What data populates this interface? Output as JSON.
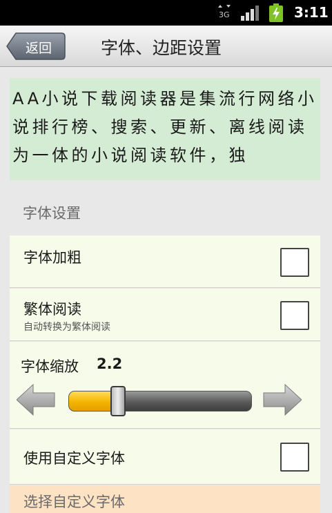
{
  "status_bar": {
    "network_label": "3G",
    "time": "3:11"
  },
  "title_bar": {
    "back_label": "返回",
    "title": "字体、边距设置"
  },
  "preview": {
    "text": "AA小说下载阅读器是集流行网络小说排行榜、搜索、更新、离线阅读为一体的小说阅读软件，独"
  },
  "font_settings": {
    "section_title": "字体设置",
    "bold": {
      "label": "字体加粗",
      "checked": false
    },
    "traditional": {
      "label": "繁体阅读",
      "sublabel": "自动转换为繁体阅读",
      "checked": false
    },
    "zoom": {
      "label": "字体缩放",
      "value": "2.2",
      "slider_fraction": 0.27
    },
    "custom_font": {
      "label": "使用自定义字体",
      "checked": false
    },
    "choose_custom_font": {
      "label": "选择自定义字体"
    }
  },
  "colors": {
    "preview_bg": "#d4ecd4",
    "row_bg": "#f7fbe9",
    "slider_fill": "#f5b400",
    "highlight_row_bg": "#fde3c4"
  }
}
